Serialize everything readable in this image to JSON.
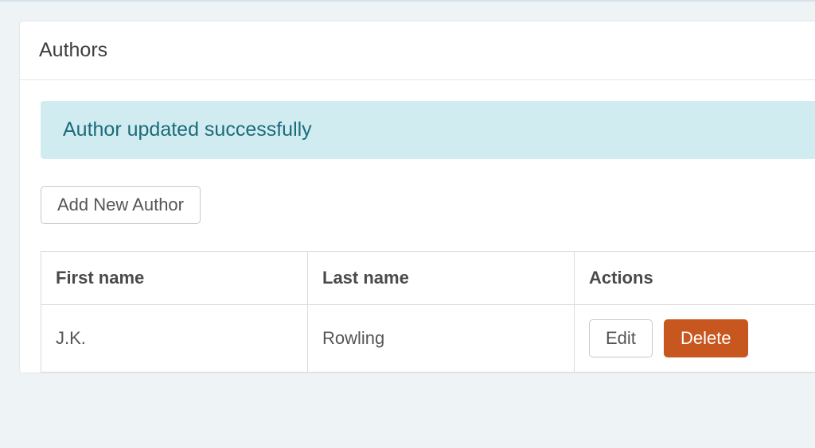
{
  "colors": {
    "alert_bg": "#d1ecf1",
    "alert_text": "#1b6b7a",
    "danger_bg": "#c7571e"
  },
  "panel": {
    "title": "Authors"
  },
  "alert": {
    "message": "Author updated successfully"
  },
  "buttons": {
    "add_new": "Add New Author",
    "edit": "Edit",
    "delete": "Delete"
  },
  "table": {
    "headers": {
      "first_name": "First name",
      "last_name": "Last name",
      "actions": "Actions"
    },
    "rows": [
      {
        "first_name": "J.K.",
        "last_name": "Rowling"
      }
    ]
  }
}
